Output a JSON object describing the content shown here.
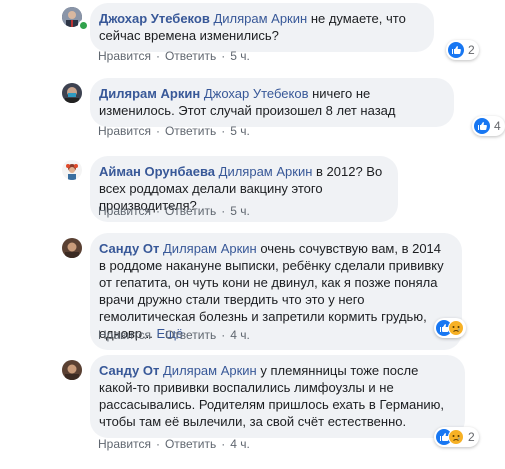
{
  "comments": [
    {
      "author": "Джохар Утебеков",
      "mention": "Дилярам Аркин",
      "text": "не думаете, что сейчас времена изменились?",
      "like_label": "Нравится",
      "reply_label": "Ответить",
      "time": "5 ч.",
      "reaction_count": "2",
      "reactions": [
        "like"
      ]
    },
    {
      "author": "Дилярам Аркин",
      "mention": "Джохар Утебеков",
      "text": "ничего не изменилось. Этот случай произошел 8 лет назад",
      "like_label": "Нравится",
      "reply_label": "Ответить",
      "time": "5 ч.",
      "reaction_count": "4",
      "reactions": [
        "like"
      ]
    },
    {
      "author": "Айман Орунбаева",
      "mention": "Дилярам Аркин",
      "text": "в 2012? Во всех роддомах делали вакцину этого производителя?",
      "like_label": "Нравится",
      "reply_label": "Ответить",
      "time": "5 ч.",
      "reaction_count": "",
      "reactions": []
    },
    {
      "author": "Санду От",
      "mention": "Дилярам Аркин",
      "text": "очень сочувствую вам, в 2014 в роддоме накануне выписки, ребёнку сделали прививку от гепатита, он чуть кони не двинул, как я позже поняла врачи дружно стали твердить что это у него гемолитическая болезнь и запретили кормить грудью, одновр...",
      "more_label": "Ещё",
      "like_label": "Нравится",
      "reply_label": "Ответить",
      "time": "4 ч.",
      "reaction_count": "",
      "reactions": [
        "like",
        "sad"
      ]
    },
    {
      "author": "Санду От",
      "mention": "Дилярам Аркин",
      "text": "у племянницы тоже после какой-то прививки воспалились лимфоузлы и не рассасывались. Родителям пришлось ехать в Германию, чтобы там её вылечили, за свой счёт естественно.",
      "like_label": "Нравится",
      "reply_label": "Ответить",
      "time": "4 ч.",
      "reaction_count": "2",
      "reactions": [
        "like",
        "sad"
      ]
    }
  ],
  "colors": {
    "link": "#385898",
    "bubble": "#f0f2f5",
    "meta": "#606770",
    "like": "#1877f2",
    "sad": "#f7b125"
  },
  "icons": [
    "avatar",
    "like-icon",
    "sad-icon",
    "online-indicator"
  ]
}
